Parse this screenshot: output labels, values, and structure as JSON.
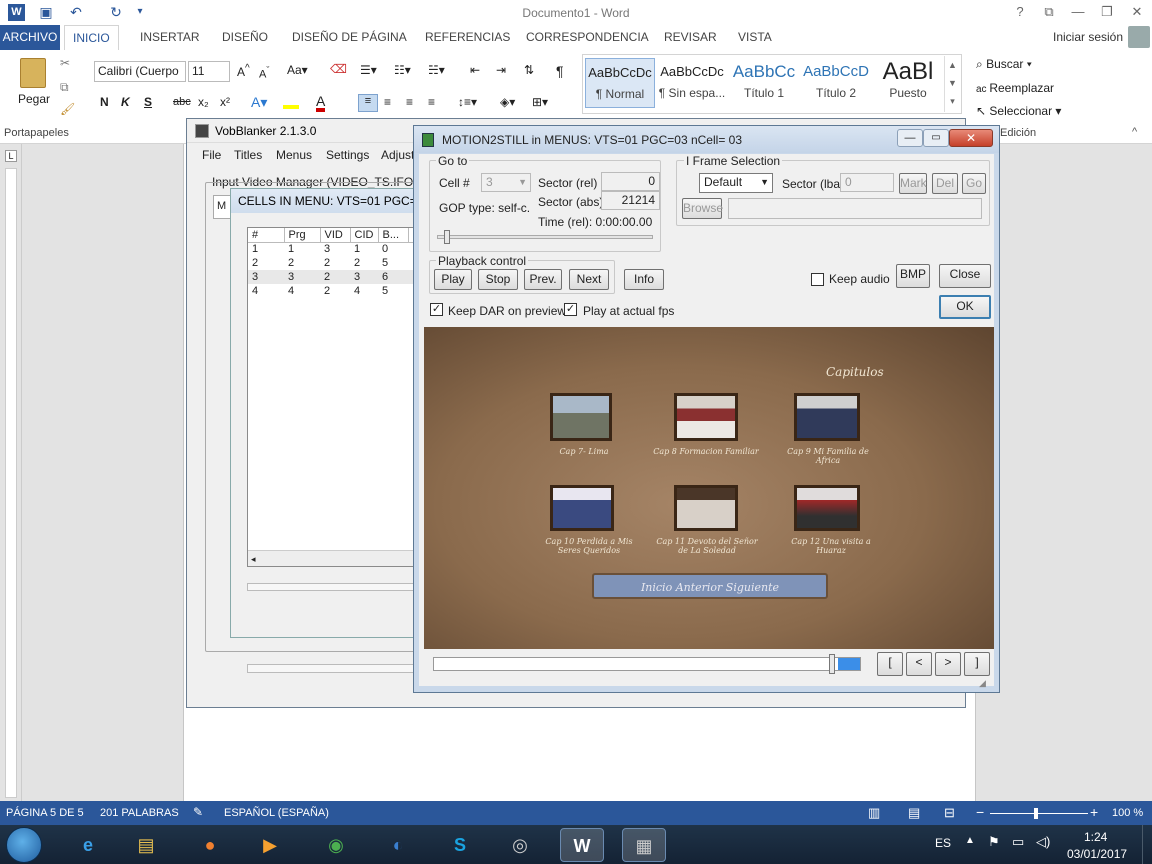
{
  "word": {
    "title": "Documento1 - Word",
    "tabs": [
      "ARCHIVO",
      "INICIO",
      "INSERTAR",
      "DISEÑO",
      "DISEÑO DE PÁGINA",
      "REFERENCIAS",
      "CORRESPONDENCIA",
      "REVISAR",
      "VISTA"
    ],
    "signin": "Iniciar sesión",
    "clipboard": {
      "paste": "Pegar",
      "group": "Portapapeles"
    },
    "font": {
      "name": "Calibri (Cuerpo",
      "size": "11",
      "bold": "N",
      "italic": "K",
      "underline": "S",
      "strike": "abc",
      "sub": "x₂",
      "sup": "x²"
    },
    "styles": [
      {
        "preview": "AaBbCcDc",
        "name": "¶ Normal"
      },
      {
        "preview": "AaBbCcDc",
        "name": "¶ Sin espa..."
      },
      {
        "preview": "AaBbCc",
        "name": "Título 1"
      },
      {
        "preview": "AaBbCcD",
        "name": "Título 2"
      },
      {
        "preview": "AaBl",
        "name": "Puesto"
      }
    ],
    "editing": {
      "find": "Buscar",
      "replace": "Reemplazar",
      "select": "Seleccionar",
      "group": "Edición"
    },
    "status": {
      "page": "PÁGINA 5 DE 5",
      "words": "201 PALABRAS",
      "lang": "ESPAÑOL (ESPAÑA)",
      "zoom": "100 %"
    }
  },
  "taskbar": {
    "lang": "ES",
    "time": "1:24",
    "date": "03/01/2017"
  },
  "vobblanker": {
    "title": "VobBlanker 2.1.3.0",
    "menu": [
      "File",
      "Titles",
      "Menus",
      "Settings",
      "Adjust"
    ],
    "input_label": "Input Video Manager (VIDEO_TS.IFO)",
    "cells_title": "CELLS IN MENU: VTS=01 PGC=01",
    "columns": [
      "#",
      "Prg",
      "VID",
      "CID",
      "B..."
    ],
    "rows": [
      [
        "1",
        "1",
        "3",
        "1",
        "0"
      ],
      [
        "2",
        "2",
        "2",
        "2",
        "5"
      ],
      [
        "3",
        "3",
        "2",
        "3",
        "6"
      ],
      [
        "4",
        "4",
        "2",
        "4",
        "5"
      ]
    ]
  },
  "still": {
    "title": "MOTION2STILL in MENUS: VTS=01 PGC=03 nCell= 03",
    "goto": {
      "label": "Go to",
      "cell_label": "Cell #",
      "cell_value": "3",
      "sector_rel_label": "Sector (rel)",
      "sector_rel": "0",
      "sector_abs_label": "Sector (abs)",
      "sector_abs": "21214",
      "gop": "GOP type: self-c.",
      "time": "Time (rel): 0:00:00.00"
    },
    "iframe": {
      "label": "I Frame Selection",
      "select": "Default",
      "lba_label": "Sector (lba)",
      "lba": "0",
      "mark": "Mark",
      "del": "Del",
      "go": "Go",
      "browse": "Browse"
    },
    "playback": {
      "label": "Playback control",
      "play": "Play",
      "stop": "Stop",
      "prev": "Prev.",
      "next": "Next"
    },
    "info": "Info",
    "keep_audio": "Keep audio",
    "bmp": "BMP",
    "close": "Close",
    "ok": "OK",
    "keep_dar": "Keep DAR on preview",
    "actual_fps": "Play at actual fps",
    "preview": {
      "heading": "Capitulos",
      "captions": [
        "Cap 7- Lima",
        "Cap 8 Formacion Familiar",
        "Cap 9 Mi Familia de Africa",
        "Cap 10 Perdida a Mis Seres Queridos",
        "Cap 11 Devoto del Señor de La Soledad",
        "Cap 12 Una visita a Huaraz"
      ],
      "nav": "Inicio Anterior Siguiente"
    },
    "navbtns": [
      "[",
      "<",
      ">",
      "]"
    ]
  },
  "colors": {
    "word_blue": "#2b579a",
    "parchment": "#8a6a4c"
  }
}
